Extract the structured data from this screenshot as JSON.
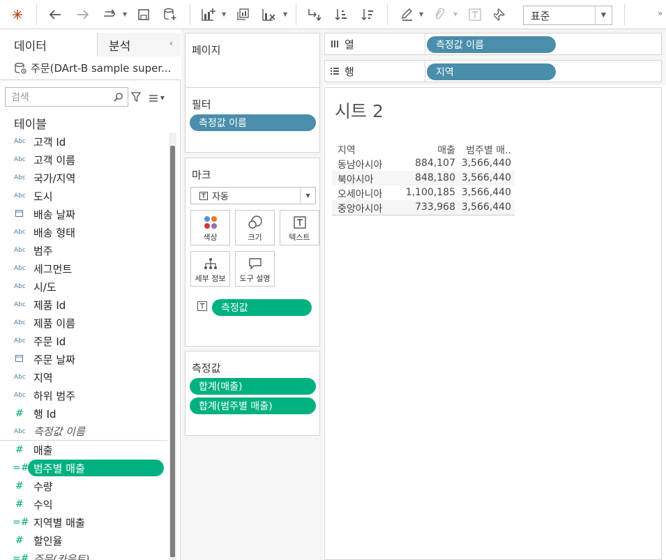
{
  "toolbar": {
    "standard_select": "표준",
    "icons": [
      "tableau-logo-icon",
      "undo-icon",
      "redo-icon",
      "replay-icon",
      "save-icon",
      "new-datasource-icon",
      "new-sheet-icon",
      "duplicate-sheet-icon",
      "clear-sheet-icon",
      "swap-rows-columns-icon",
      "sort-ascending-icon",
      "sort-descending-icon",
      "highlight-icon",
      "group-icon",
      "show-labels-icon",
      "pin-icon",
      "more-icon"
    ],
    "more": "»"
  },
  "data_pane": {
    "tab_data": "데이터",
    "tab_analysis": "분석",
    "collapse": "‹",
    "datasource": "주문(DArt-B sample super...",
    "search_placeholder": "검색",
    "tables_header": "테이블",
    "fields": [
      {
        "type": "Abc",
        "label": "고객 Id"
      },
      {
        "type": "Abc",
        "label": "고객 이름"
      },
      {
        "type": "Abc",
        "label": "국가/지역"
      },
      {
        "type": "Abc",
        "label": "도시"
      },
      {
        "type": "date",
        "label": "배송 날짜"
      },
      {
        "type": "Abc",
        "label": "배송 형태"
      },
      {
        "type": "Abc",
        "label": "범주"
      },
      {
        "type": "Abc",
        "label": "세그먼트"
      },
      {
        "type": "Abc",
        "label": "시/도"
      },
      {
        "type": "Abc",
        "label": "제품 Id"
      },
      {
        "type": "Abc",
        "label": "제품 이름"
      },
      {
        "type": "Abc",
        "label": "주문 Id"
      },
      {
        "type": "date",
        "label": "주문 날짜"
      },
      {
        "type": "Abc",
        "label": "지역"
      },
      {
        "type": "Abc",
        "label": "하위 범주"
      },
      {
        "type": "#",
        "label": "행 Id"
      },
      {
        "type": "Abc",
        "label": "측정값 이름"
      },
      {
        "type": "#",
        "label": "매출"
      },
      {
        "type": "=#",
        "label": "범주별 매출"
      },
      {
        "type": "#",
        "label": "수량"
      },
      {
        "type": "#",
        "label": "수익"
      },
      {
        "type": "=#",
        "label": "지역별 매출"
      },
      {
        "type": "#",
        "label": "할인율"
      },
      {
        "type": "=#",
        "label": "주문(카운트)"
      }
    ]
  },
  "cards": {
    "pages": "페이지",
    "filters": "필터",
    "filter_pill": "측정값 이름",
    "marks": "마크",
    "mark_type": "자동",
    "mark_buttons": {
      "color": "색상",
      "size": "크기",
      "text": "텍스트",
      "detail": "세부 정보",
      "tooltip": "도구 설명"
    },
    "marks_pill": "측정값",
    "measure_values": "측정값",
    "measure_pills": [
      "합계(매출)",
      "합계(범주별 매출)"
    ]
  },
  "shelves": {
    "columns_label": "열",
    "columns_pill": "측정값 이름",
    "rows_label": "행",
    "rows_pill": "지역"
  },
  "view": {
    "title": "시트 2",
    "headers": [
      "지역",
      "매출",
      "범주별 매.."
    ],
    "rows": [
      [
        "동남아시아",
        "884,107",
        "3,566,440"
      ],
      [
        "북아시아",
        "848,180",
        "3,566,440"
      ],
      [
        "오세아니아",
        "1,100,185",
        "3,566,440"
      ],
      [
        "중앙아시아",
        "733,968",
        "3,566,440"
      ]
    ]
  },
  "colors": {
    "dimension_pill": "#4a8eab",
    "measure_pill": "#00b180",
    "selected_field": "#00b180"
  }
}
